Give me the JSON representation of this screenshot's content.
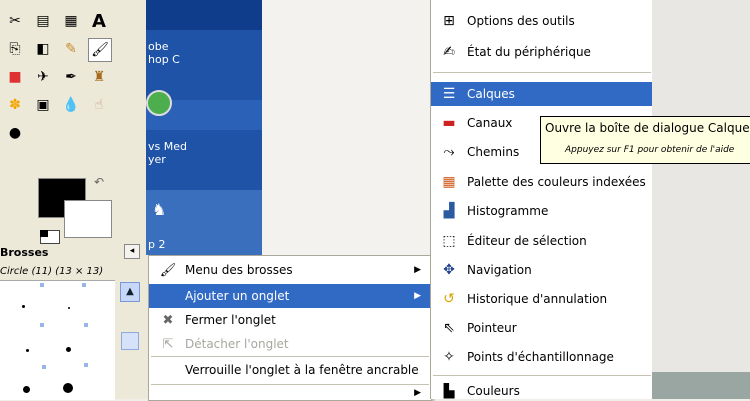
{
  "brushes_panel": {
    "title": "Brosses",
    "selected_brush": "Circle (11) (13 × 13)",
    "close_glyph": "◂"
  },
  "desktop": {
    "icons_text": [
      "obe",
      "hop C",
      "vs Med",
      "yer",
      "p 2"
    ]
  },
  "context_menu": {
    "items": [
      {
        "label": "Menu des brosses",
        "icon": "brush-icon",
        "submenu": true,
        "state": "normal"
      },
      {
        "label": "Ajouter un onglet",
        "icon": "none",
        "submenu": true,
        "state": "highlighted"
      },
      {
        "label": "Fermer l'onglet",
        "icon": "close-x-icon",
        "submenu": false,
        "state": "normal"
      },
      {
        "label": "Détacher l'onglet",
        "icon": "detach-icon",
        "submenu": false,
        "state": "disabled"
      },
      {
        "label": "Verrouille l'onglet à la fenêtre ancrable",
        "icon": "none",
        "submenu": false,
        "state": "normal"
      }
    ]
  },
  "dialogs_menu": {
    "items": [
      {
        "label": "Options des outils",
        "icon": "tool-options-icon"
      },
      {
        "label": "État du périphérique",
        "icon": "device-status-icon"
      },
      {
        "label": "Calques",
        "icon": "layers-icon",
        "highlighted": true
      },
      {
        "label": "Canaux",
        "icon": "channels-icon"
      },
      {
        "label": "Chemins",
        "icon": "paths-icon"
      },
      {
        "label": "Palette des couleurs indexées",
        "icon": "palette-icon"
      },
      {
        "label": "Histogramme",
        "icon": "histogram-icon"
      },
      {
        "label": "Éditeur de sélection",
        "icon": "selection-editor-icon"
      },
      {
        "label": "Navigation",
        "icon": "navigation-icon"
      },
      {
        "label": "Historique d'annulation",
        "icon": "undo-history-icon"
      },
      {
        "label": "Pointeur",
        "icon": "pointer-icon"
      },
      {
        "label": "Points d'échantillonnage",
        "icon": "sample-points-icon"
      },
      {
        "label": "Couleurs",
        "icon": "colors-icon"
      }
    ]
  },
  "tooltip": {
    "text": "Ouvre la boîte de dialogue Calques",
    "hint": "Appuyez sur F1 pour obtenir de l'aide"
  },
  "colors": {
    "highlight": "#316ac5",
    "menu_bg": "#ffffff",
    "tooltip_bg": "#ffffe1",
    "desktop_blue": "#1e53a8"
  }
}
